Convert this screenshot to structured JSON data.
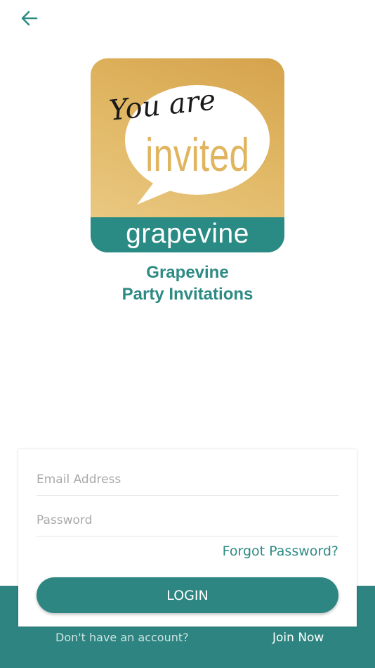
{
  "header": {
    "back_icon": "arrow-left-icon"
  },
  "logo": {
    "script_text": "You are",
    "big_text": "invited",
    "band_text": "grapevine"
  },
  "app": {
    "title_line1": "Grapevine",
    "title_line2": "Party Invitations"
  },
  "form": {
    "email_placeholder": "Email Address",
    "password_placeholder": "Password",
    "forgot_label": "Forgot Password?",
    "login_label": "LOGIN"
  },
  "footer": {
    "prompt": "Don't have an account?",
    "join_label": "Join Now"
  },
  "colors": {
    "accent": "#2e8a84",
    "logo_gold": "#e0b662",
    "footer_bg": "#2d8480"
  }
}
